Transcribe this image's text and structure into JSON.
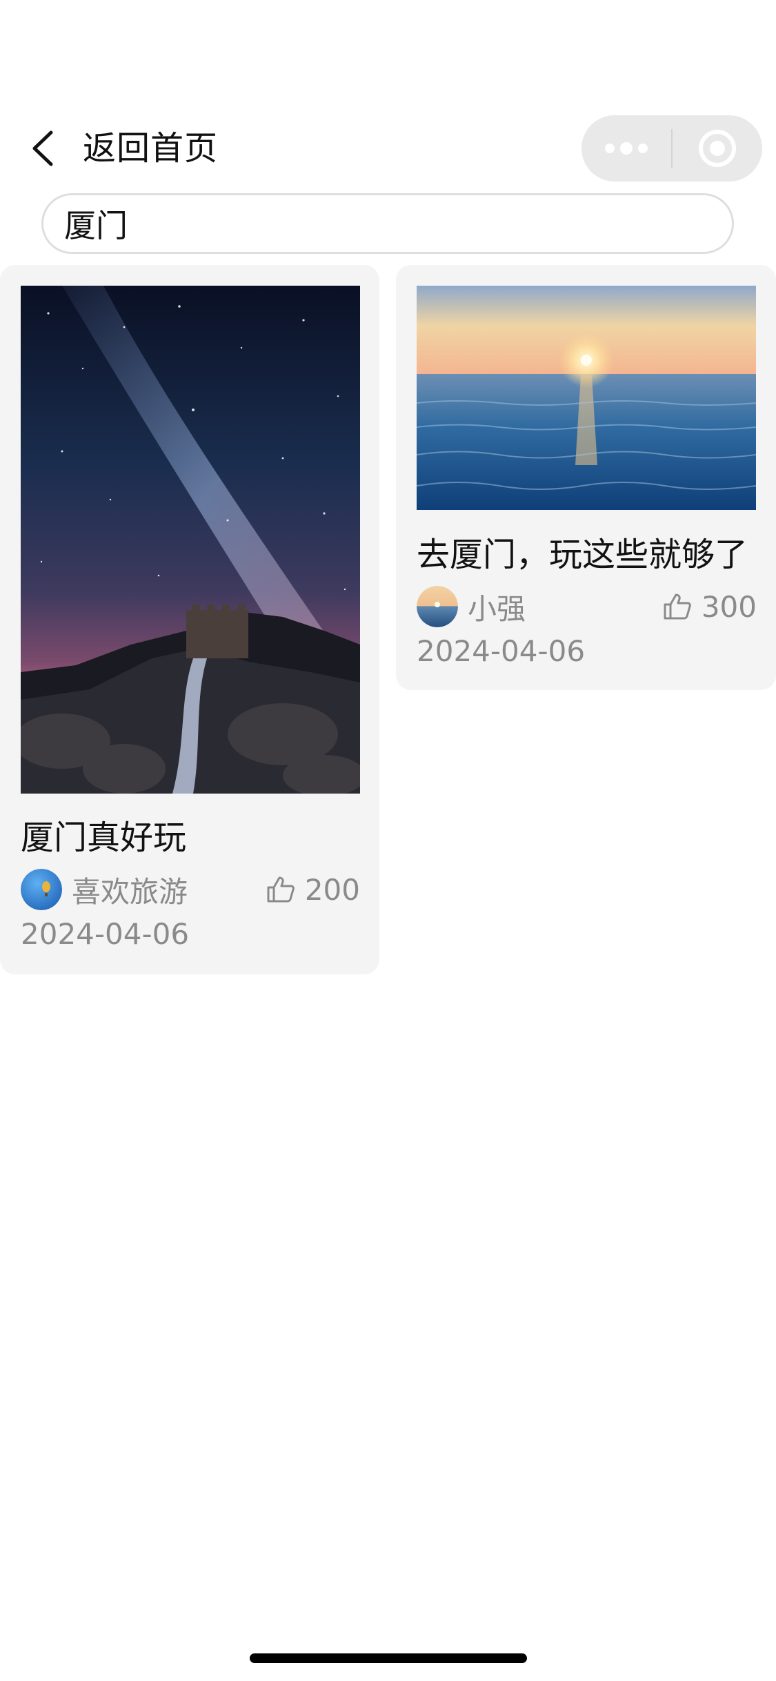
{
  "nav": {
    "title": "返回首页"
  },
  "search": {
    "value": "厦门"
  },
  "results": [
    {
      "title": "厦门真好玩",
      "author": "喜欢旅游",
      "likes": "200",
      "date": "2024-04-06",
      "image": "great-wall-night-milky-way-photo"
    },
    {
      "title": "去厦门，玩这些就够了",
      "author": "小强",
      "likes": "300",
      "date": "2024-04-06",
      "image": "sea-sunset-photo"
    }
  ],
  "colors": {
    "card_bg": "#f4f4f4",
    "meta_text": "#8a8a8a",
    "title_text": "#111111",
    "capsule_bg": "#e9e9e9"
  }
}
